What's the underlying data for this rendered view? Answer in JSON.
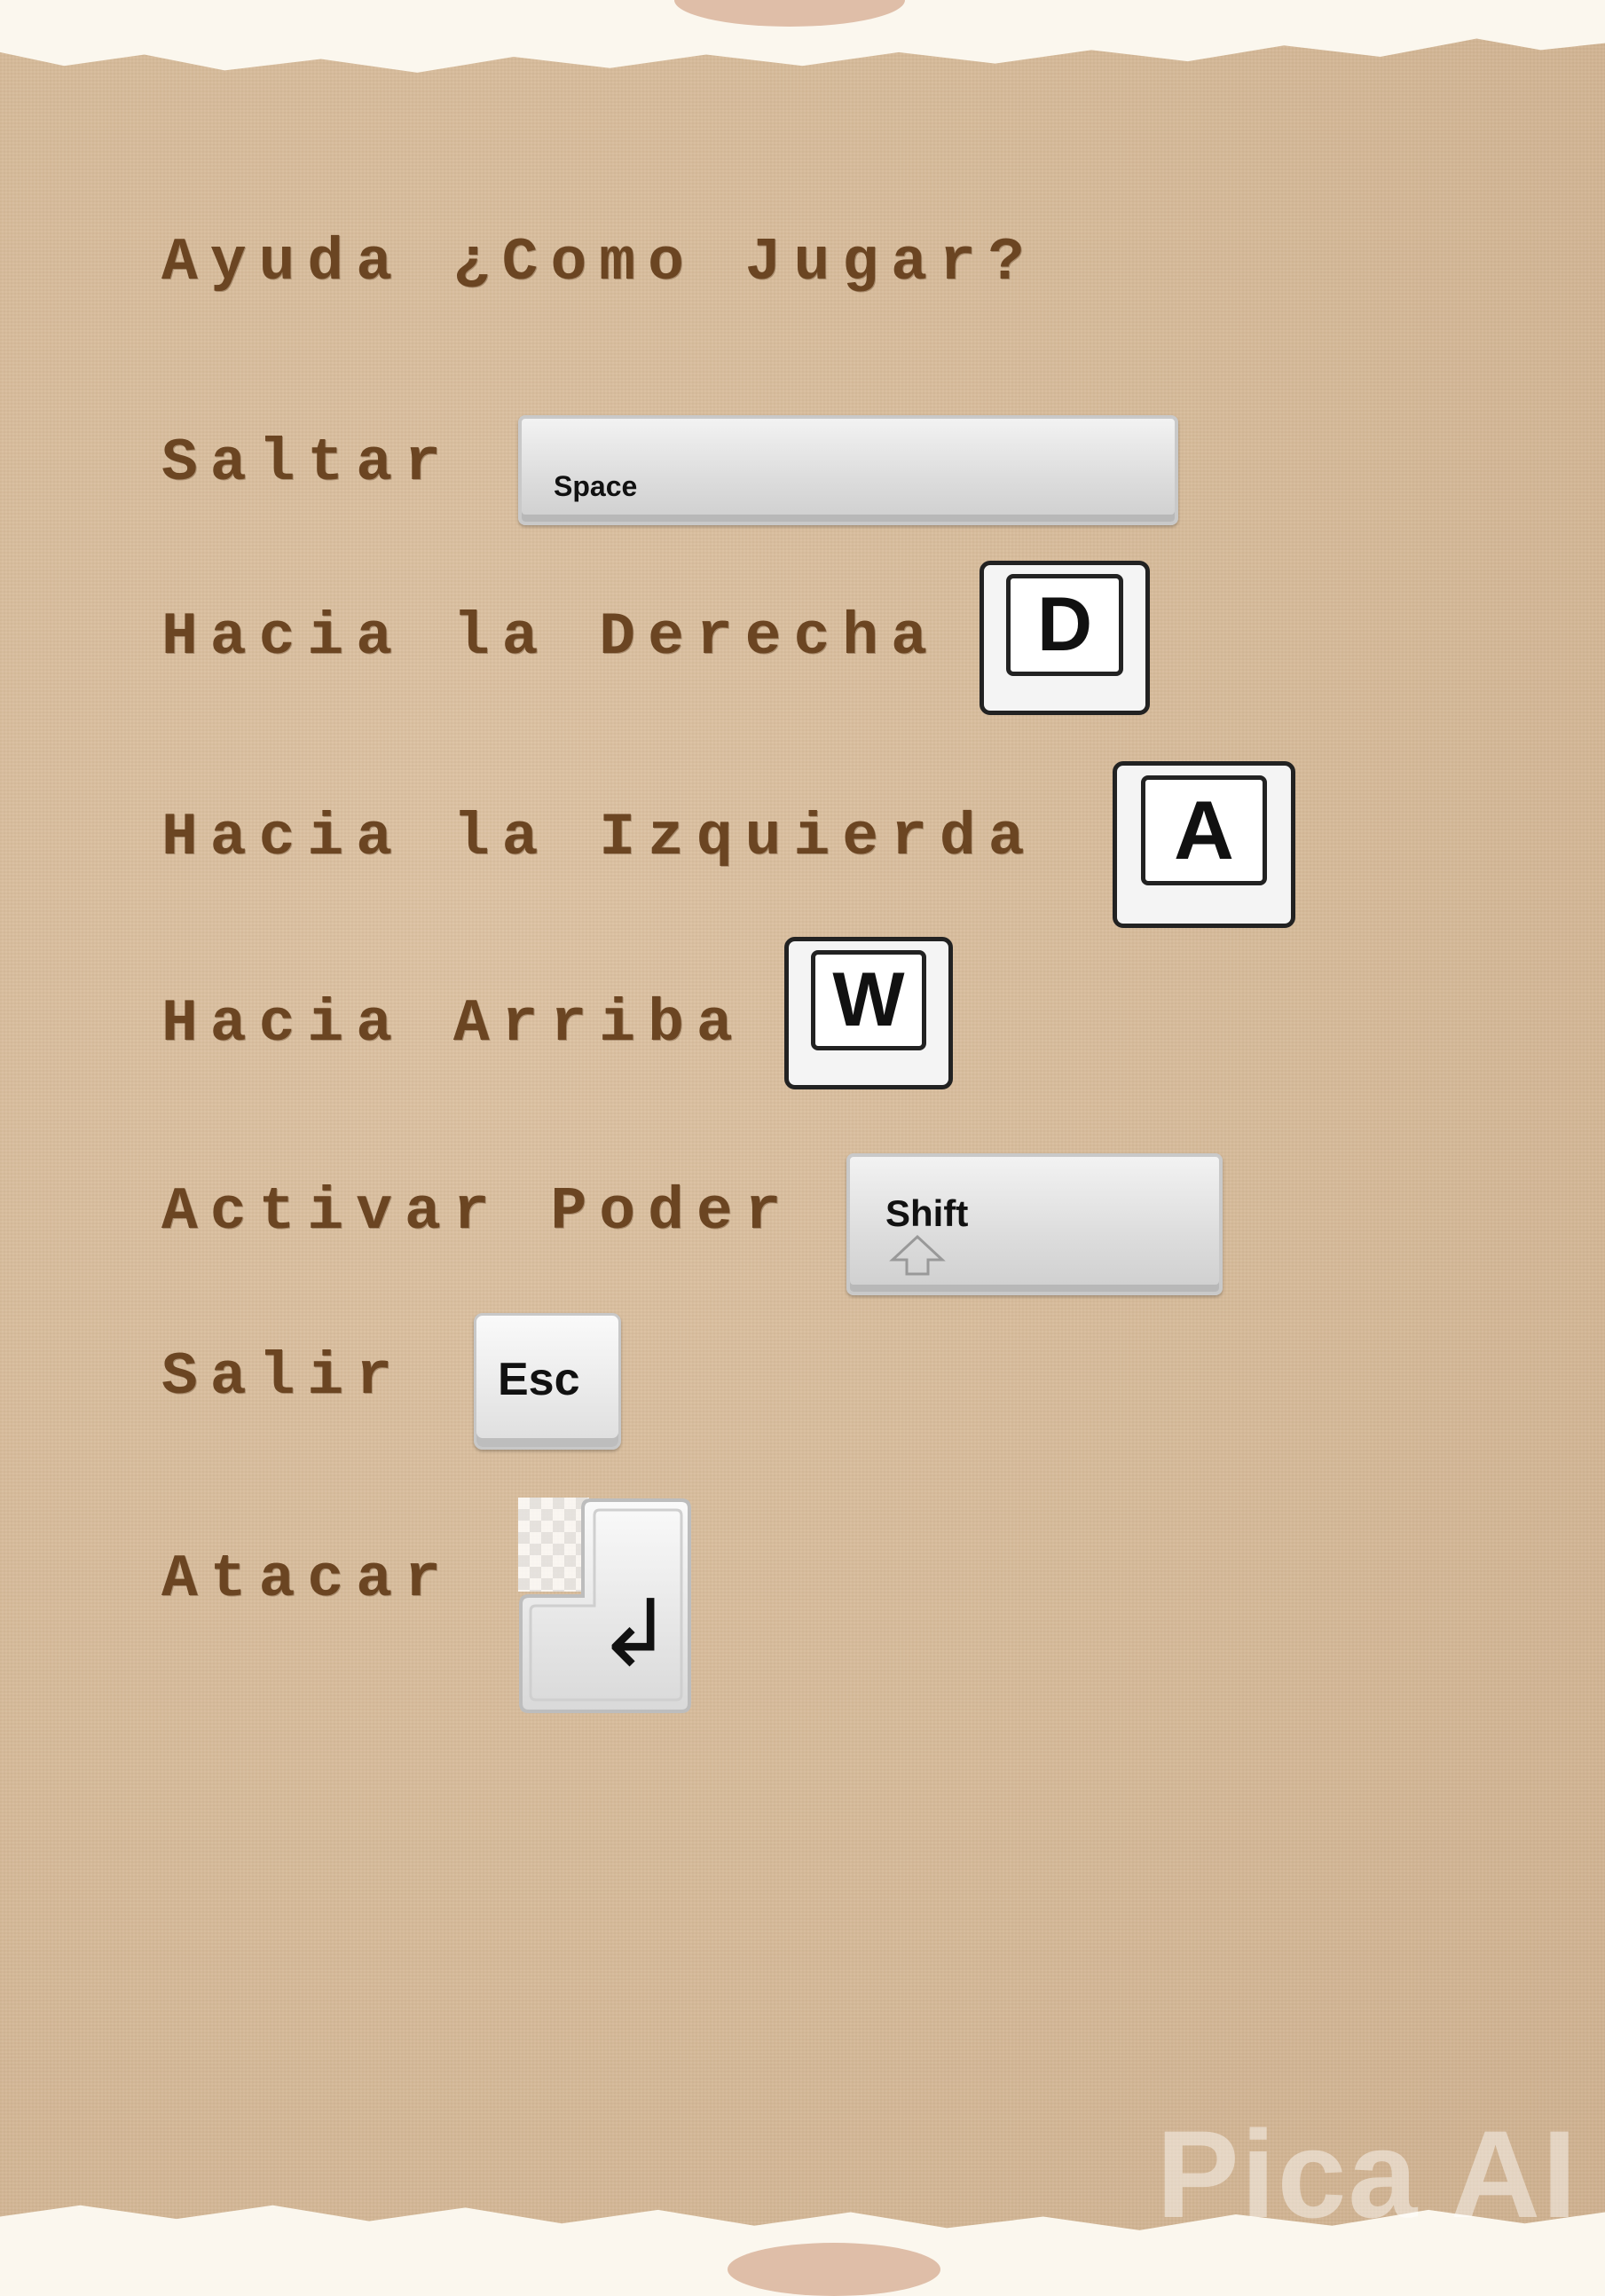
{
  "title": "Ayuda ¿Como Jugar?",
  "controls": [
    {
      "action": "Saltar",
      "key": "Space",
      "key_icon": "space-key-icon"
    },
    {
      "action": "Hacia la Derecha",
      "key": "D",
      "key_icon": "d-key-icon"
    },
    {
      "action": "Hacia la Izquierda",
      "key": "A",
      "key_icon": "a-key-icon"
    },
    {
      "action": "Hacia Arriba",
      "key": "W",
      "key_icon": "w-key-icon"
    },
    {
      "action": "Activar Poder",
      "key": "Shift",
      "key_icon": "shift-key-icon"
    },
    {
      "action": "Salir",
      "key": "Esc",
      "key_icon": "esc-key-icon"
    },
    {
      "action": "Atacar",
      "key": "↲",
      "key_icon": "enter-key-icon"
    }
  ],
  "watermark": "Pica AI",
  "colors": {
    "text": "#6b4522",
    "paper": "#d6bb9a",
    "background": "#fbf7ee"
  }
}
